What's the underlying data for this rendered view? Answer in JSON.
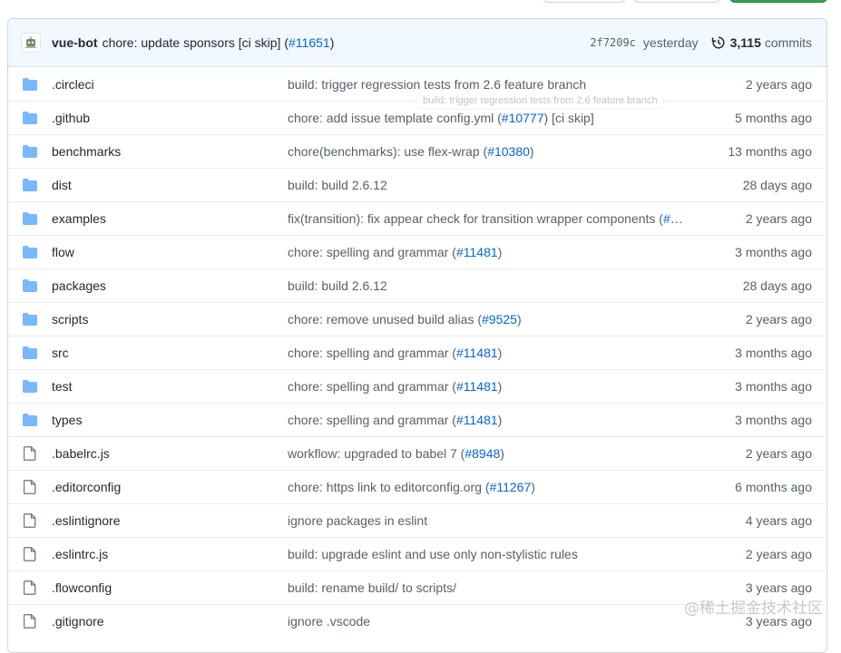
{
  "commit": {
    "author": "vue-bot",
    "message": "chore: update sponsors [ci skip] (",
    "pr_link": "#11651",
    "message_end": ")",
    "sha": "2f7209c",
    "time": "yesterday",
    "commit_count": "3,115",
    "commits_label": "commits"
  },
  "tooltip": "build: trigger regression tests from 2.6 feature branch",
  "watermark": "@稀土掘金技术社区",
  "colors": {
    "folder": "#79b8ff",
    "link": "#0366d6",
    "header_bg": "#f1f8ff",
    "primary_button": "#2ea44f"
  },
  "files": [
    {
      "type": "folder",
      "icon": "folder-icon",
      "name": ".circleci",
      "msg": "build: trigger regression tests from 2.6 feature branch",
      "link": "",
      "msg_end": "",
      "time": "2 years ago"
    },
    {
      "type": "folder",
      "icon": "folder-icon",
      "name": ".github",
      "msg": "chore: add issue template config.yml (",
      "link": "#10777",
      "msg_end": ") [ci skip]",
      "time": "5 months ago"
    },
    {
      "type": "folder",
      "icon": "folder-icon",
      "name": "benchmarks",
      "msg": "chore(benchmarks): use flex-wrap (",
      "link": "#10380",
      "msg_end": ")",
      "time": "13 months ago"
    },
    {
      "type": "folder",
      "icon": "folder-icon",
      "name": "dist",
      "msg": "build: build 2.6.12",
      "link": "",
      "msg_end": "",
      "time": "28 days ago"
    },
    {
      "type": "folder",
      "icon": "folder-icon",
      "name": "examples",
      "msg": "fix(transition): fix appear check for transition wrapper components (",
      "link": "#…",
      "msg_end": "",
      "time": "2 years ago"
    },
    {
      "type": "folder",
      "icon": "folder-icon",
      "name": "flow",
      "msg": "chore: spelling and grammar (",
      "link": "#11481",
      "msg_end": ")",
      "time": "3 months ago"
    },
    {
      "type": "folder",
      "icon": "folder-icon",
      "name": "packages",
      "msg": "build: build 2.6.12",
      "link": "",
      "msg_end": "",
      "time": "28 days ago"
    },
    {
      "type": "folder",
      "icon": "folder-icon",
      "name": "scripts",
      "msg": "chore: remove unused build alias (",
      "link": "#9525",
      "msg_end": ")",
      "time": "2 years ago"
    },
    {
      "type": "folder",
      "icon": "folder-icon",
      "name": "src",
      "msg": "chore: spelling and grammar (",
      "link": "#11481",
      "msg_end": ")",
      "time": "3 months ago"
    },
    {
      "type": "folder",
      "icon": "folder-icon",
      "name": "test",
      "msg": "chore: spelling and grammar (",
      "link": "#11481",
      "msg_end": ")",
      "time": "3 months ago"
    },
    {
      "type": "folder",
      "icon": "folder-icon",
      "name": "types",
      "msg": "chore: spelling and grammar (",
      "link": "#11481",
      "msg_end": ")",
      "time": "3 months ago"
    },
    {
      "type": "file",
      "icon": "file-icon",
      "name": ".babelrc.js",
      "msg": "workflow: upgraded to babel 7 (",
      "link": "#8948",
      "msg_end": ")",
      "time": "2 years ago"
    },
    {
      "type": "file",
      "icon": "file-icon",
      "name": ".editorconfig",
      "msg": "chore: https link to editorconfig.org (",
      "link": "#11267",
      "msg_end": ")",
      "time": "6 months ago"
    },
    {
      "type": "file",
      "icon": "file-icon",
      "name": ".eslintignore",
      "msg": "ignore packages in eslint",
      "link": "",
      "msg_end": "",
      "time": "4 years ago"
    },
    {
      "type": "file",
      "icon": "file-icon",
      "name": ".eslintrc.js",
      "msg": "build: upgrade eslint and use only non-stylistic rules",
      "link": "",
      "msg_end": "",
      "time": "2 years ago"
    },
    {
      "type": "file",
      "icon": "file-icon",
      "name": ".flowconfig",
      "msg": "build: rename build/ to scripts/",
      "link": "",
      "msg_end": "",
      "time": "3 years ago"
    },
    {
      "type": "file",
      "icon": "file-icon",
      "name": ".gitignore",
      "msg": "ignore .vscode",
      "link": "",
      "msg_end": "",
      "time": "3 years ago"
    }
  ]
}
